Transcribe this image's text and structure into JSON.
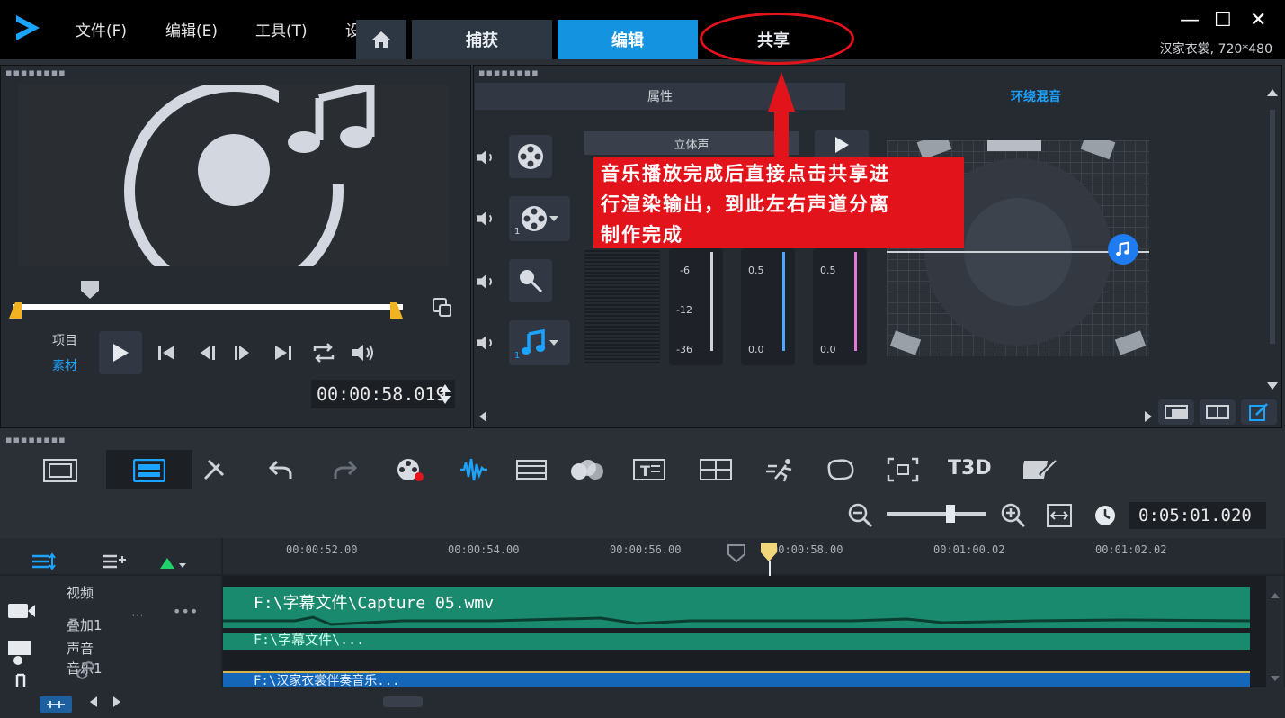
{
  "menu": [
    "文件(F)",
    "编辑(E)",
    "工具(T)",
    "设"
  ],
  "tabs": {
    "capture": "捕获",
    "edit": "编辑",
    "share": "共享"
  },
  "window": {
    "minimize": "—",
    "maximize": "☐",
    "close": "✕",
    "project_info": "汉家衣裳, 720*480"
  },
  "player": {
    "mode_project": "项目",
    "mode_clip": "素材",
    "timecode": "00:00:58.019"
  },
  "mixer": {
    "tab_properties": "属性",
    "tab_surround": "环绕混音",
    "stereo": "立体声",
    "meter_labels": [
      "-6",
      "-12",
      "-36"
    ],
    "slider1_labels": [
      "0.5",
      "0.0"
    ],
    "slider2_labels": [
      "0.5",
      "0.0"
    ],
    "track_badge_1": "1",
    "track_badge_2": "1"
  },
  "annotation": {
    "line1": "音乐播放完成后直接点击共享进",
    "line2": "行渲染输出，到此左右声道分离",
    "line3": "制作完成"
  },
  "toolbar": {
    "zoom_timecode": "0:05:01.020",
    "t3d_label": "T3D"
  },
  "ruler": [
    "00:00:52.00",
    "00:00:54.00",
    "00:00:56.00",
    "00:00:58.00",
    "00:01:00.02",
    "00:01:02.02"
  ],
  "tracks": {
    "video": "视频",
    "overlay": "叠加1",
    "voice": "声音",
    "music": "音乐1",
    "clip_video": "F:\\字幕文件\\Capture 05.wmv",
    "clip_overlay": "F:\\字幕文件\\...",
    "clip_music": "F:\\汉家衣裳伴奏音乐..."
  },
  "colors": {
    "accent": "#1493e0",
    "annotation": "#e3131b",
    "clip": "#1a8a6f"
  }
}
